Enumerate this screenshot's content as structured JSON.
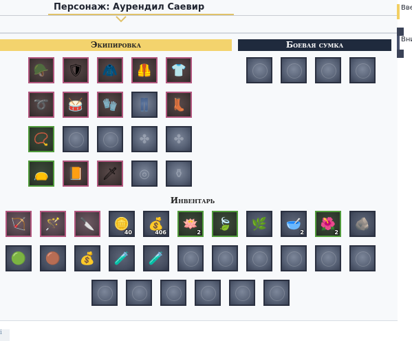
{
  "title": "Персонаж: Аурендил Саевир",
  "sidebar": {
    "top_label": "Вве",
    "bottom_label": "Вни"
  },
  "equipment": {
    "header": "Экипировка",
    "slots": [
      {
        "icon": "hood-icon",
        "glyph": "🪖",
        "frame": "pink",
        "state": "item"
      },
      {
        "icon": "shoulder-armor-icon",
        "glyph": "🛡",
        "frame": "pink",
        "state": "item"
      },
      {
        "icon": "cape-icon",
        "glyph": "🧥",
        "frame": "pink",
        "state": "item"
      },
      {
        "icon": "chest-armor-icon",
        "glyph": "🦺",
        "frame": "pink",
        "state": "item"
      },
      {
        "icon": "white-tunic-icon",
        "glyph": "👕",
        "frame": "pink",
        "state": "item"
      },
      {
        "icon": "belt-icon",
        "glyph": "➰",
        "frame": "pink",
        "state": "item"
      },
      {
        "icon": "bracers-icon",
        "glyph": "🥁",
        "frame": "pink",
        "state": "item"
      },
      {
        "icon": "gloves-icon",
        "glyph": "🧤",
        "frame": "pink",
        "state": "item"
      },
      {
        "icon": "leggings-placeholder-icon",
        "glyph": "👖",
        "frame": "none",
        "state": "ghost"
      },
      {
        "icon": "boots-icon",
        "glyph": "👢",
        "frame": "pink",
        "state": "item"
      },
      {
        "icon": "amulet-icon",
        "glyph": "📿",
        "frame": "green",
        "state": "item"
      },
      {
        "icon": "ring-placeholder-icon",
        "glyph": "",
        "frame": "none",
        "state": "empty"
      },
      {
        "icon": "ring-placeholder-icon",
        "glyph": "",
        "frame": "none",
        "state": "empty"
      },
      {
        "icon": "earring-placeholder-icon",
        "glyph": "✤",
        "frame": "none",
        "state": "ghost"
      },
      {
        "icon": "earring-placeholder-icon",
        "glyph": "✤",
        "frame": "none",
        "state": "ghost"
      },
      {
        "icon": "pouch-icon",
        "glyph": "👝",
        "frame": "green",
        "state": "item"
      },
      {
        "icon": "book-icon",
        "glyph": "📙",
        "frame": "pink",
        "state": "item"
      },
      {
        "icon": "dagger-icon",
        "glyph": "🗡",
        "frame": "pink",
        "state": "item"
      },
      {
        "icon": "shield-placeholder-icon",
        "glyph": "◎",
        "frame": "none",
        "state": "ghost"
      },
      {
        "icon": "trinket-placeholder-icon",
        "glyph": "⚱",
        "frame": "none",
        "state": "ghost"
      }
    ]
  },
  "battle_bag": {
    "header": "Боевая сумка",
    "slots": [
      {
        "state": "empty"
      },
      {
        "state": "empty"
      },
      {
        "state": "empty"
      },
      {
        "state": "empty"
      }
    ]
  },
  "inventory": {
    "header": "Инвентарь",
    "slots": [
      {
        "icon": "bow-icon",
        "glyph": "🏹",
        "frame": "pink",
        "state": "item",
        "count": ""
      },
      {
        "icon": "staff-icon",
        "glyph": "🪄",
        "frame": "pink",
        "state": "item",
        "count": ""
      },
      {
        "icon": "knife-icon",
        "glyph": "🔪",
        "frame": "pink",
        "state": "item",
        "count": ""
      },
      {
        "icon": "silver-coins-icon",
        "glyph": "🪙",
        "frame": "neutral",
        "state": "item",
        "count": "40"
      },
      {
        "icon": "gold-coins-icon",
        "glyph": "💰",
        "frame": "neutral",
        "state": "item",
        "count": "406"
      },
      {
        "icon": "lotus-icon",
        "glyph": "🪷",
        "frame": "green",
        "state": "item",
        "count": "2"
      },
      {
        "icon": "leaf-icon",
        "glyph": "🍃",
        "frame": "green",
        "state": "item",
        "count": ""
      },
      {
        "icon": "herb-icon",
        "glyph": "🌿",
        "frame": "neutral",
        "state": "item",
        "count": ""
      },
      {
        "icon": "salt-bowl-icon",
        "glyph": "🥣",
        "frame": "neutral",
        "state": "item",
        "count": "2"
      },
      {
        "icon": "flower-icon",
        "glyph": "🌺",
        "frame": "green",
        "state": "item",
        "count": "2"
      },
      {
        "icon": "ore-icon",
        "glyph": "🪨",
        "frame": "neutral",
        "state": "item",
        "count": ""
      },
      {
        "icon": "emerald-orb-icon",
        "glyph": "🟢",
        "frame": "neutral",
        "state": "item",
        "count": ""
      },
      {
        "icon": "bronze-orb-icon",
        "glyph": "🟤",
        "frame": "neutral",
        "state": "item",
        "count": ""
      },
      {
        "icon": "sack-icon",
        "glyph": "💰",
        "frame": "neutral",
        "state": "item",
        "count": ""
      },
      {
        "icon": "red-potion-icon",
        "glyph": "🧪",
        "frame": "neutral",
        "state": "item",
        "count": ""
      },
      {
        "icon": "green-potion-icon",
        "glyph": "🧪",
        "frame": "neutral",
        "state": "item",
        "count": ""
      },
      {
        "state": "empty"
      },
      {
        "state": "empty"
      },
      {
        "state": "empty"
      },
      {
        "state": "empty"
      },
      {
        "state": "empty"
      },
      {
        "state": "empty"
      },
      {
        "state": "empty"
      },
      {
        "state": "empty"
      },
      {
        "state": "empty"
      },
      {
        "state": "empty"
      },
      {
        "state": "empty"
      },
      {
        "state": "empty"
      }
    ]
  },
  "footer": {
    "label": "i"
  },
  "colors": {
    "gold": "#f3d36d",
    "navy": "#1f2a3d",
    "pink_frame": "#b2567e",
    "green_frame": "#4f9a3a"
  }
}
